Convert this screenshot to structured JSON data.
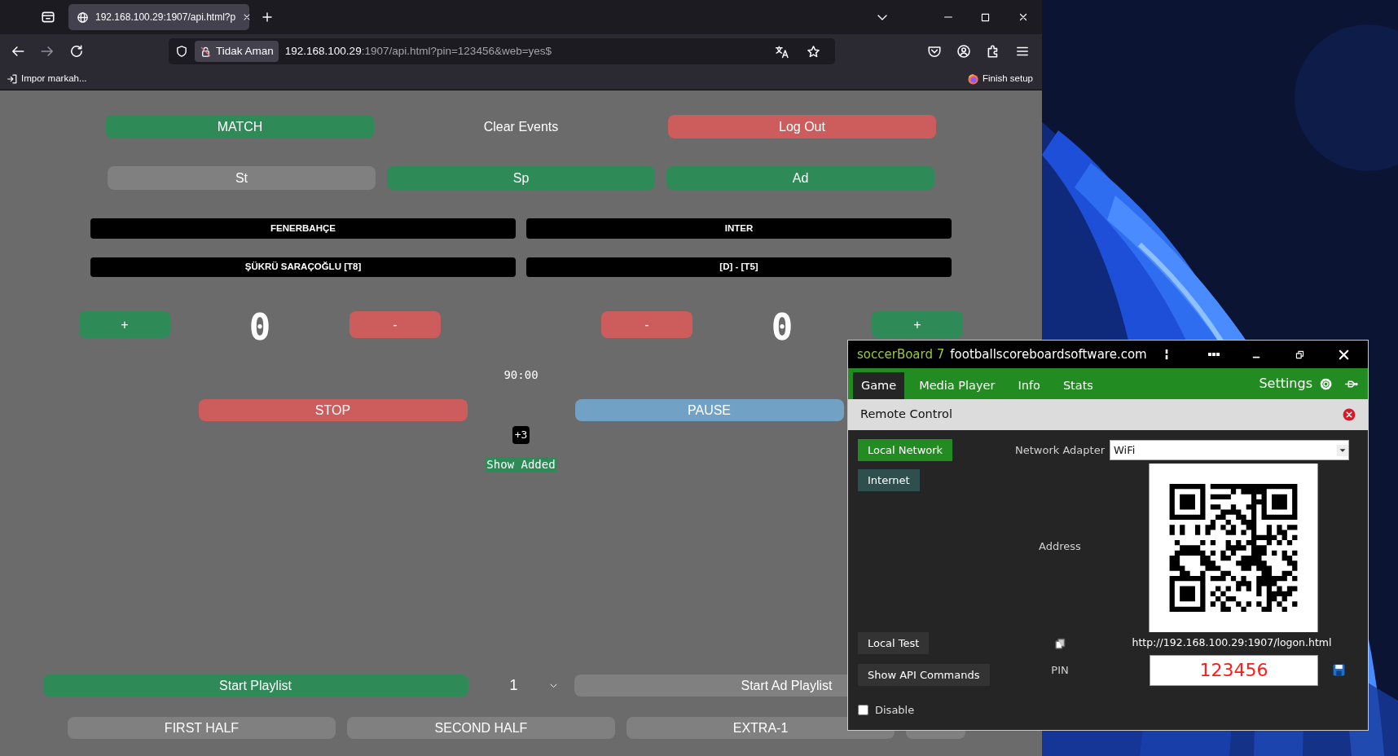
{
  "browser": {
    "tab_title": "192.168.100.29:1907/api.html?p",
    "security_label": "Tidak Aman",
    "url_host": "192.168.100.29",
    "url_rest": ":1907/api.html?pin=123456&web=yes$",
    "bookmark": "Impor markah...",
    "finish_setup": "Finish setup"
  },
  "page": {
    "top_buttons": [
      {
        "label": "MATCH",
        "kind": "green"
      },
      {
        "label": "Clear Events",
        "kind": "plain"
      },
      {
        "label": "Log Out",
        "kind": "red"
      }
    ],
    "mode_buttons": [
      {
        "label": "St",
        "kind": "gray"
      },
      {
        "label": "Sp",
        "kind": "green"
      },
      {
        "label": "Ad",
        "kind": "green"
      }
    ],
    "teams": [
      {
        "name": "FENERBAHÇE",
        "info": "ŞÜKRÜ SARAÇOĞLU [T8]",
        "score": "0",
        "plus": "+",
        "minus": "-"
      },
      {
        "name": "INTER",
        "info": "[D] - [T5]",
        "score": "0",
        "plus": "+",
        "minus": "-"
      }
    ],
    "clock": "90:00",
    "clock_buttons": [
      {
        "label": "STOP",
        "kind": "red"
      },
      {
        "label": "PAUSE",
        "kind": "blue"
      }
    ],
    "added_time": "+3",
    "show_added": "Show Added",
    "playlist": {
      "start": "Start Playlist",
      "number": "1",
      "start_ad": "Start Ad Playlist"
    },
    "periods": [
      "FIRST HALF",
      "SECOND HALF",
      "EXTRA-1"
    ]
  },
  "app": {
    "brand": "soccerBoard 7",
    "site": "footballscoreboardsoftware.com",
    "tabs": [
      {
        "label": "Game",
        "selected": true
      },
      {
        "label": "Media Player",
        "selected": false
      },
      {
        "label": "Info",
        "selected": false
      },
      {
        "label": "Stats",
        "selected": false
      }
    ],
    "settings": "Settings",
    "panel_title": "Remote Control",
    "modes": [
      {
        "label": "Local Network",
        "selected": true
      },
      {
        "label": "Internet",
        "selected": false
      }
    ],
    "adapter_label": "Network Adapter",
    "adapter_value": "WiFi",
    "address_label": "Address",
    "url": "http://192.168.100.29:1907/logon.html",
    "local_test": "Local Test",
    "show_api": "Show API Commands",
    "pin_label": "PIN",
    "pin": "123456",
    "disable": {
      "label": "Disable",
      "checked": false
    }
  }
}
